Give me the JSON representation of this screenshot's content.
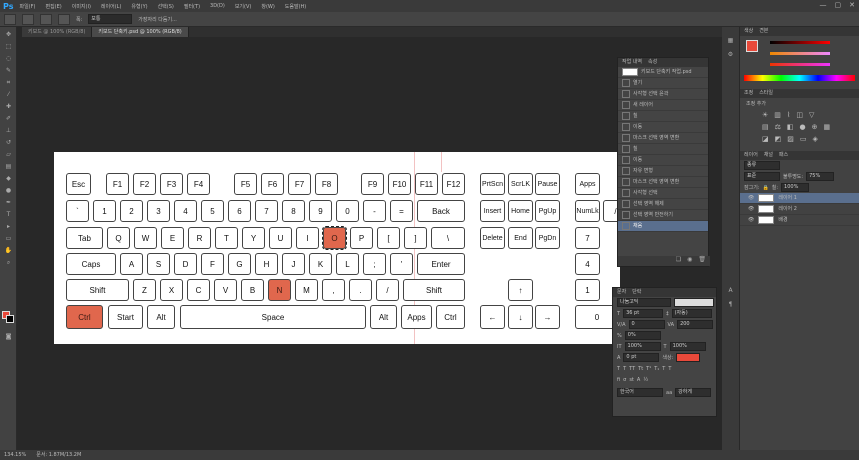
{
  "app": {
    "logo": "Ps"
  },
  "menu": [
    "파일(F)",
    "편집(E)",
    "이미지(I)",
    "레이어(L)",
    "유형(Y)",
    "선택(S)",
    "필터(T)",
    "3D(D)",
    "보기(V)",
    "창(W)",
    "도움말(H)"
  ],
  "window_buttons": [
    "—",
    "▢",
    "✕"
  ],
  "options": {
    "width_label": "폭:",
    "mode_value": "보통",
    "refine_label": "가장자리 다듬기..."
  },
  "tabs": [
    "키보드 @ 100% (RGB/8)",
    "키보드 단축키.psd @ 100% (RGB/8)"
  ],
  "right_panels": {
    "color_tabs": [
      "색상",
      "견본"
    ],
    "adjust_tabs": [
      "조정",
      "스타일"
    ],
    "adjust_label": "조정 추가",
    "layers_tabs": [
      "레이어",
      "채널",
      "패스"
    ],
    "layer_kind": "종류",
    "opacity_label": "불투명도:",
    "opacity_value": "75%",
    "lock_label": "잠그기:",
    "fill_label": "칠:",
    "fill_value": "100%",
    "layers": [
      {
        "name": "레이어 1",
        "selected": true
      },
      {
        "name": "레이어 2",
        "selected": false
      },
      {
        "name": "배경",
        "selected": false
      }
    ]
  },
  "history": {
    "tabs": [
      "작업 내역",
      "속성"
    ],
    "snapshot": "키보드 단축키 작업.psd",
    "items": [
      "열기",
      "사각형 선택 윤곽",
      "새 레이어",
      "칠",
      "이동",
      "마스크 선택 영역 변환",
      "칠",
      "이동",
      "자유 변형",
      "마스크 선택 영역 변환",
      "사각형 선택",
      "선택 영역 해제",
      "선택 영역 반전하기",
      "채움"
    ],
    "selected_index": 13
  },
  "character": {
    "tabs": [
      "문자",
      "단락"
    ],
    "font": "나눔고딕",
    "size": "36 pt",
    "leading": "(자동)",
    "tracking": "0",
    "kerning": "200",
    "scale_v": "100%",
    "scale_h": "100%",
    "baseline": "0 pt",
    "color_label": "색상:",
    "language": "한국어",
    "aa": "강하게"
  },
  "colors": {
    "foreground": "#e8493a",
    "highlight_key": "#e0674d",
    "selection": "#5a6f8e"
  },
  "status": {
    "zoom": "134.15%",
    "doc": "문서: 1.87M/13.2M"
  },
  "keyboard": {
    "row_fn": [
      "Esc",
      "F1",
      "F2",
      "F3",
      "F4",
      "F5",
      "F6",
      "F7",
      "F8",
      "F9",
      "F10",
      "F11",
      "F12"
    ],
    "row_num": [
      "`",
      "1",
      "2",
      "3",
      "4",
      "5",
      "6",
      "7",
      "8",
      "9",
      "0",
      "-",
      "=",
      "Back"
    ],
    "row_q": [
      "Tab",
      "Q",
      "W",
      "E",
      "R",
      "T",
      "Y",
      "U",
      "I",
      "O",
      "P",
      "[",
      "]",
      "\\"
    ],
    "row_a": [
      "Caps",
      "A",
      "S",
      "D",
      "F",
      "G",
      "H",
      "J",
      "K",
      "L",
      ";",
      "'",
      "Enter"
    ],
    "row_z": [
      "Shift",
      "Z",
      "X",
      "C",
      "V",
      "B",
      "N",
      "M",
      ",",
      ".",
      "/",
      "Shift"
    ],
    "row_bottom": [
      "Ctrl",
      "Start",
      "Alt",
      "Space",
      "Alt",
      "Apps",
      "Ctrl"
    ],
    "nav_top": [
      "PrtScn",
      "ScrLK",
      "Pause"
    ],
    "nav_1": [
      "Insert",
      "Home",
      "PgUp"
    ],
    "nav_2": [
      "Delete",
      "End",
      "PgDn"
    ],
    "arrows": [
      "↑",
      "←",
      "↓",
      "→"
    ],
    "numpad": [
      "Apps",
      "NumLk",
      "/",
      "7",
      "4",
      "1",
      "0"
    ],
    "highlighted": [
      "O",
      "N",
      "Ctrl"
    ]
  }
}
